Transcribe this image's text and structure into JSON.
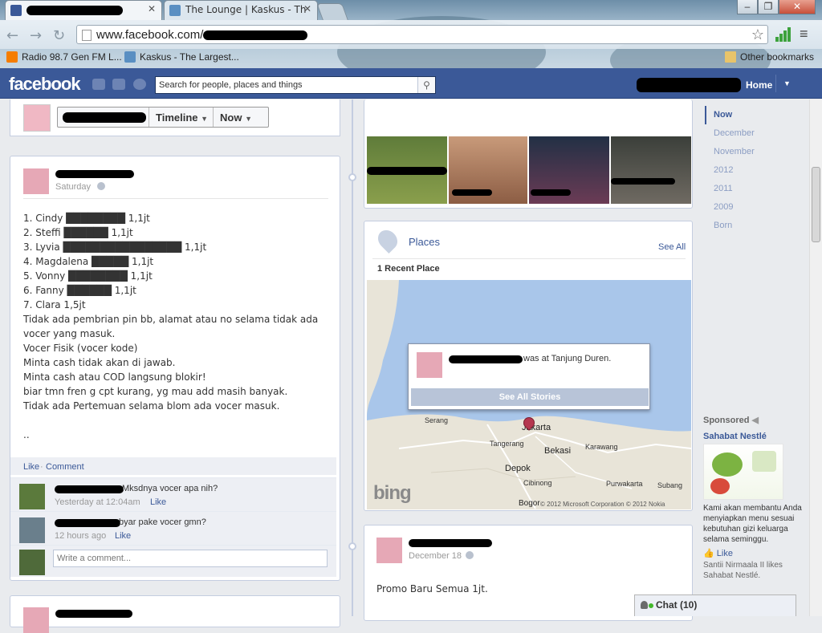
{
  "browser": {
    "tabs": [
      {
        "title": "",
        "favicon": "facebook-icon"
      },
      {
        "title": "The Lounge | Kaskus - Th",
        "favicon": "kaskus-icon"
      }
    ],
    "window_controls": [
      "minimize",
      "maximize",
      "close"
    ],
    "url_prefix": "www.facebook.com/",
    "bookmarks": [
      {
        "label": "Radio 98.7 Gen FM L...",
        "icon": "blogger-icon"
      },
      {
        "label": "Kaskus - The Largest...",
        "icon": "kaskus-icon"
      }
    ],
    "other_bookmarks": "Other bookmarks"
  },
  "fb": {
    "logo": "facebook",
    "search_placeholder": "Search for people, places and things",
    "home": "Home"
  },
  "cover": {
    "timeline_btn": "Timeline",
    "now_btn": "Now"
  },
  "post1": {
    "date": "Saturday",
    "body": "1. Cindy ████████ 1,1jt\n2. Steffi ██████ 1,1jt\n3. Lyvia ████████████████ 1,1jt\n4. Magdalena █████ 1,1jt\n5. Vonny ████████ 1,1jt\n6. Fanny ██████ 1,1jt\n7. Clara 1,5jt\nTidak ada pembrian pin bb, alamat atau no selama tidak ada vocer yang masuk.\nVocer Fisik (vocer kode)\nMinta cash tidak akan di jawab.\nMinta cash atau COD langsung blokir!\nbiar tmn fren g cpt kurang, yg mau add masih banyak.\nTidak ada Pertemuan selama blom ada vocer masuk.\n\n..",
    "like": "Like",
    "comment": "Comment",
    "comments": [
      {
        "text": "Mksdnya vocer apa nih?",
        "time": "Yesterday at 12:04am",
        "like": "Like"
      },
      {
        "text": "byar pake vocer gmn?",
        "time": "12 hours ago",
        "like": "Like"
      }
    ],
    "write_placeholder": "Write a comment..."
  },
  "places": {
    "title": "Places",
    "see_all": "See All",
    "recent": "1 Recent Place",
    "story_suffix": "was at Tanjung Duren.",
    "see_all_stories": "See All Stories",
    "map_labels": [
      "Serang",
      "Jakarta",
      "Tangerang",
      "Karawang",
      "Bekasi",
      "Depok",
      "Purwakarta",
      "Cibinong",
      "Subang",
      "Bogor"
    ],
    "map_copyright": "© 2012 Microsoft Corporation © 2012 Nokia",
    "map_brand": "bing"
  },
  "post2": {
    "date": "December 18",
    "body": "Promo Baru Semua 1jt."
  },
  "sidebar": {
    "years": [
      "Now",
      "December",
      "November",
      "2012",
      "2011",
      "2009",
      "Born"
    ],
    "sponsored": "Sponsored",
    "ad_title": "Sahabat Nestlé",
    "ad_text": "Kami akan membantu Anda menyiapkan menu sesuai kebutuhan gizi keluarga selama seminggu.",
    "ad_like": "Like",
    "ad_social": "Santii Nirmaala II likes Sahabat Nestlé."
  },
  "chat": {
    "label": "Chat (10)"
  },
  "colors": {
    "fb_blue": "#3b5998",
    "link": "#3b5998",
    "page_bg": "#e9ebee"
  }
}
